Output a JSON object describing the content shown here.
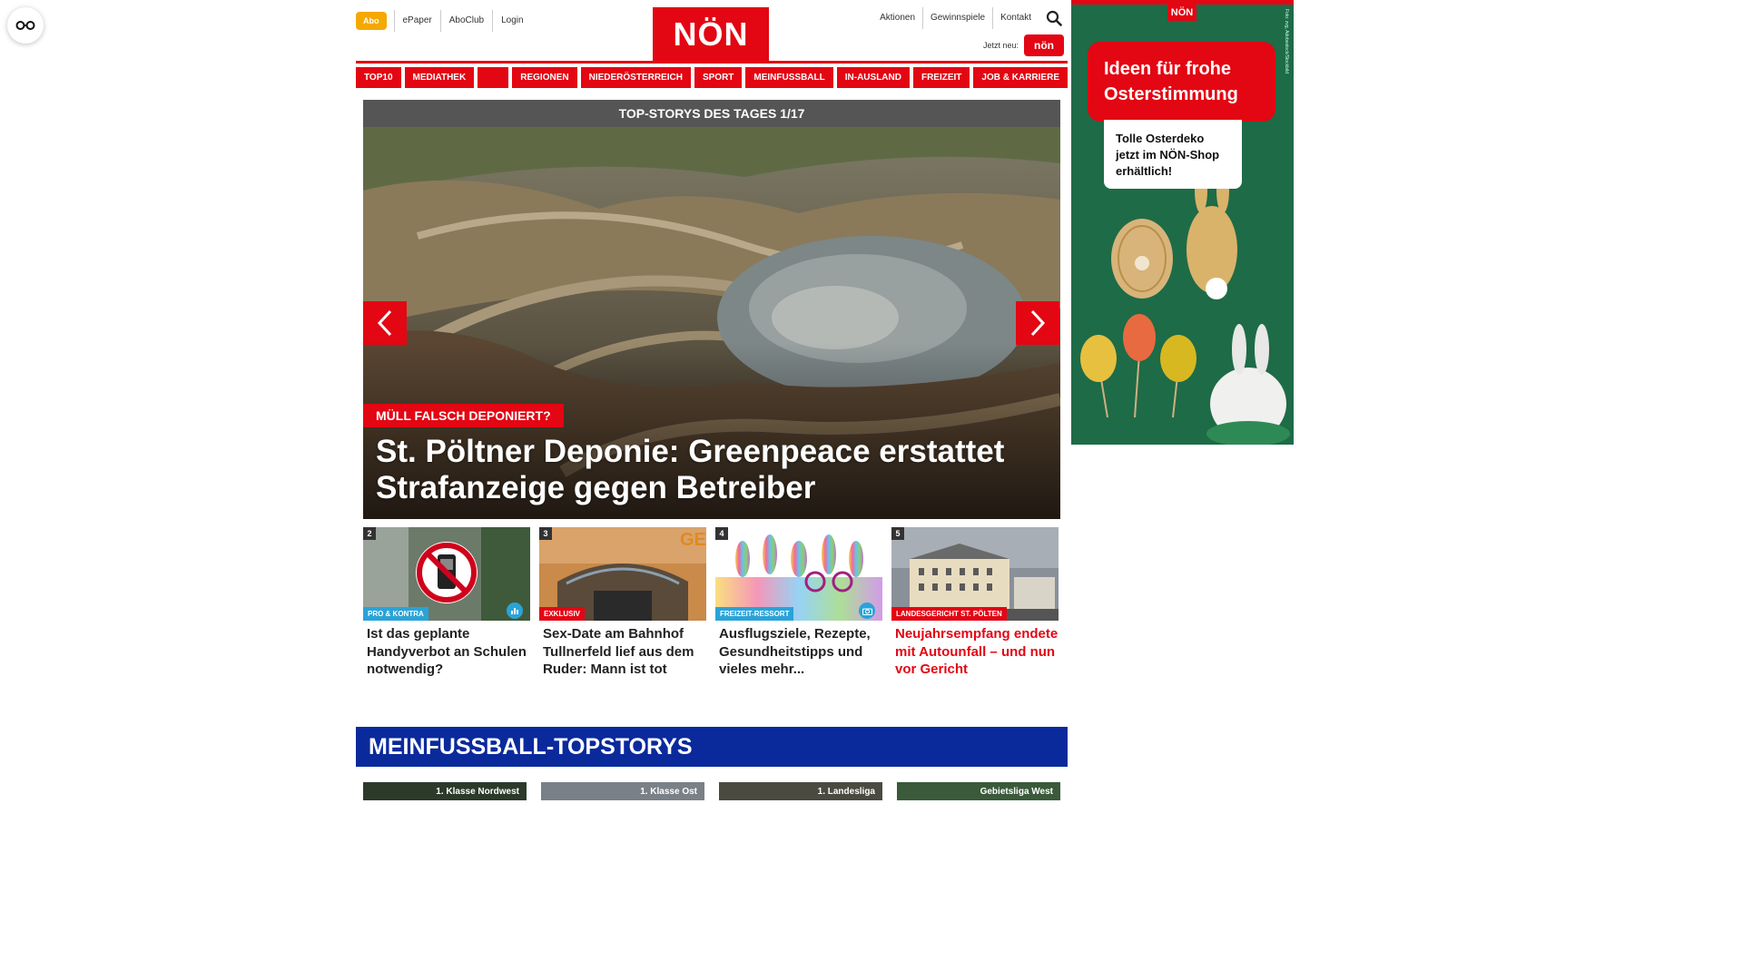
{
  "colors": {
    "brand_red": "#e30613",
    "abo_orange": "#f5a800",
    "slider_header": "#555555",
    "tag_blue": "#2aa3d8",
    "meinfussball_blue": "#0a2a9c",
    "ad_green": "#1e6b47"
  },
  "float_button": {
    "icon": "glasses-icon"
  },
  "header": {
    "abo_label": "Abo",
    "top_links": [
      "ePaper",
      "AboClub",
      "Login"
    ],
    "logo": "NÖN",
    "right_links": [
      "Aktionen",
      "Gewinnspiele",
      "Kontakt"
    ],
    "search_icon": "search-icon",
    "jetzt_label": "Jetzt neu:",
    "jetzt_badge": "nön"
  },
  "nav": {
    "items": [
      "TOP10",
      "MEDIATHEK",
      "",
      "REGIONEN",
      "NIEDERÖSTERREICH",
      "SPORT",
      "MEINFUSSBALL",
      "IN-AUSLAND",
      "FREIZEIT",
      "JOB & KARRIERE"
    ]
  },
  "slider": {
    "header": "TOP-STORYS DES TAGES 1/17",
    "kicker": "MÜLL FALSCH DEPONIERT?",
    "headline": "St. Pöltner Deponie: Greenpeace erstattet Strafanzeige gegen Betreiber",
    "prev_icon": "chevron-left-icon",
    "next_icon": "chevron-right-icon"
  },
  "stories": [
    {
      "num": "2",
      "tag": "PRO & KONTRA",
      "tag_color": "blue",
      "icon": "chart-icon",
      "title": "Ist das geplante Handyverbot an Schulen notwendig?",
      "title_color": "dark"
    },
    {
      "num": "3",
      "tag": "EXKLUSIV",
      "tag_color": "red",
      "icon": "",
      "title": "Sex-Date am Bahnhof Tullnerfeld lief aus dem Ruder: Mann ist tot",
      "title_color": "dark"
    },
    {
      "num": "4",
      "tag": "FREIZEIT-RESSORT",
      "tag_color": "blue",
      "icon": "camera-icon",
      "title": "Ausflugsziele, Rezepte, Gesundheitstipps und vieles mehr...",
      "title_color": "dark"
    },
    {
      "num": "5",
      "tag": "LANDESGERICHT ST. PÖLTEN",
      "tag_color": "red",
      "icon": "",
      "title": "Neujahrsempfang endete mit Autounfall – und nun vor Gericht",
      "title_color": "red"
    }
  ],
  "meinfussball": {
    "title": "MEINFUSSBALL-TOPSTORYS",
    "cards": [
      "1. Klasse Nordwest",
      "1. Klasse Ost",
      "1. Landesliga",
      "Gebietsliga West"
    ]
  },
  "ad": {
    "logo": "NÖN",
    "bubble": "Ideen für frohe Osterstimmung",
    "box": "Tolle Osterdeko jetzt im NÖN-Shop erhältlich!",
    "side_text": "Foto: zvg, Adobestock/Stockbild"
  }
}
